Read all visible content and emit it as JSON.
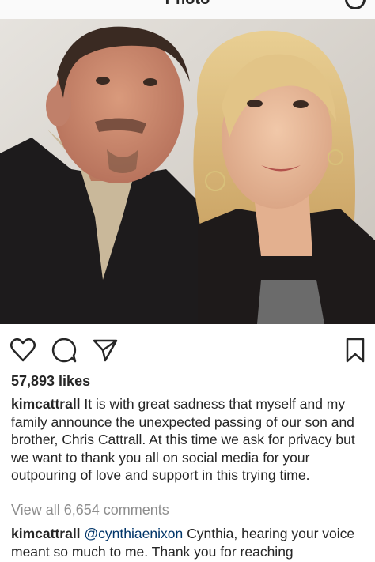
{
  "header": {
    "title": "Photo",
    "more_icon": "more-options-icon"
  },
  "post": {
    "image_alt": "",
    "actions": {
      "like_icon": "heart-icon",
      "comment_icon": "comment-icon",
      "share_icon": "send-icon",
      "save_icon": "bookmark-icon"
    },
    "likes": "57,893 likes",
    "caption": {
      "username": "kimcattrall",
      "text": " It is with great sadness that myself and my family announce the unexpected passing of our son and brother, Chris Cattrall. At this time we ask for privacy but we want to thank you all on social media for your outpouring of love and support in this trying time."
    },
    "view_all_comments": "View all 6,654 comments",
    "comments": [
      {
        "username": "kimcattrall",
        "mention": "@cynthiaenixon",
        "text": " Cynthia, hearing your voice meant so much to me. Thank you for reaching"
      }
    ]
  }
}
